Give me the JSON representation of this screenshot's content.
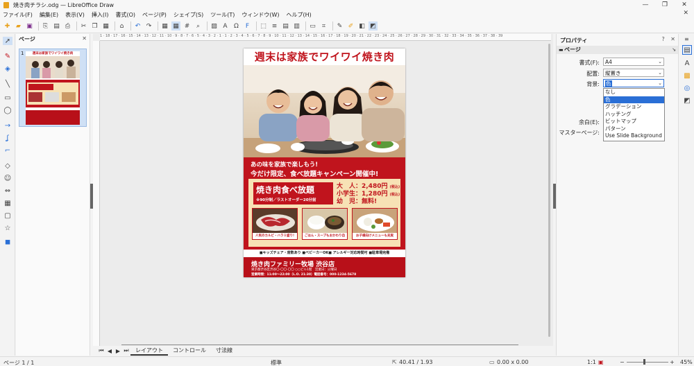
{
  "window": {
    "title": "焼き肉チラシ.odg — LibreOffice Draw",
    "minimize": "—",
    "maximize": "❐",
    "close": "✕"
  },
  "menubar": {
    "items": [
      "ファイル(F)",
      "編集(E)",
      "表示(V)",
      "挿入(I)",
      "書式(O)",
      "ページ(P)",
      "シェイプ(S)",
      "ツール(T)",
      "ウィンドウ(W)",
      "ヘルプ(H)"
    ],
    "close": "✕"
  },
  "pages_pane": {
    "title": "ページ",
    "close": "✕",
    "thumb_number": "1"
  },
  "ruler": {
    "labels": "1 · 18 · 17 · 16 · 15 · 14 · 13 · 12 · 11 · 10 · 9 · 8 · 7 · 6 · 5 · 4 · 3 · 2 · 1 · 1 · 2 · 3 · 4 · 5 · 6 · 7 · 8 · 9 · 10 · 11 · 12 · 13 · 14 · 15 · 16 · 17 · 18 · 19 · 20 · 21 · 22 · 23 · 24 · 25 · 26 · 27 · 28 · 29 · 30 · 31 · 32 · 33 · 34 · 35 · 36 · 37 · 38 · 39"
  },
  "flyer": {
    "title": "週末は家族でワイワイ焼き肉",
    "line1": "あの味を家族で楽しもう!",
    "line2": "今だけ限定、食べ放題キャンペーン開催中!",
    "tabehoudai": "焼き肉食べ放題",
    "tabehoudai_sub": "※90分制／ラストオーダー20分前",
    "price_adult": "大　人：2,480円",
    "price_child": "小学生：1,280円",
    "price_infant": "幼　児：無料!",
    "tax": "(税込)",
    "dish1": "人気のカルビ・ハラミ盛り!",
    "dish2": "ごはん・スープもおかわり自由!",
    "dish3": "お子様向けメニューも充実",
    "features": "■キッズチェア・席数あり ■ベビーカーOK■ アレルギー対応時間可 ■駐車場完備",
    "store": "焼き肉ファミリー牧場 渋谷店",
    "address": "東京都渋谷区渋谷〇-〇〇-〇〇 ○○ビル1階　営業日：火曜日",
    "hours": "営業時間：11:00〜22:00（L.O. 21:30）電話番号：000-1234-5678"
  },
  "bottom_tabs": {
    "items": [
      "レイアウト",
      "コントロール",
      "寸法線"
    ],
    "active": 0
  },
  "statusbar": {
    "page": "ページ 1 / 1",
    "layout": "標準",
    "position": "40.41 / 1.93",
    "size": "0.00 x 0.00",
    "scale": "1:1",
    "zoom": "45%"
  },
  "sidebar": {
    "title": "プロパティ",
    "section": "ページ",
    "format_label": "書式(F):",
    "format_value": "A4",
    "orientation_label": "配置:",
    "orientation_value": "縦置き",
    "background_label": "背景:",
    "background_value": "色",
    "margin_label": "余白(E):",
    "master_label": "マスターページ:",
    "background_options": [
      "なし",
      "色",
      "グラデーション",
      "ハッチング",
      "ビットマップ",
      "パターン",
      "Use Slide Background"
    ],
    "background_selected": 1,
    "help": "?",
    "close": "✕"
  },
  "colors": {
    "brand_red": "#c0141d",
    "cream": "#f7e2b5",
    "accent_blue": "#2a6fd6"
  }
}
